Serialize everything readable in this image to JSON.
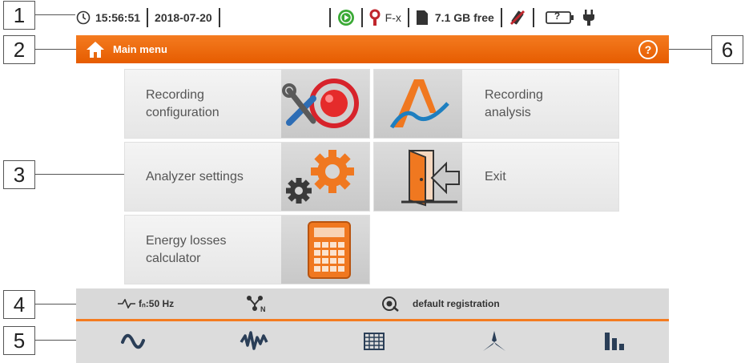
{
  "callouts": [
    "1",
    "2",
    "3",
    "4",
    "5",
    "6"
  ],
  "status": {
    "time": "15:56:51",
    "date": "2018-07-20",
    "phase": "F-x",
    "storage": "7.1 GB free",
    "battery": "?"
  },
  "titlebar": {
    "title": "Main menu",
    "help": "?"
  },
  "tiles": {
    "recording_configuration": "Recording\nconfiguration",
    "recording_analysis": "Recording\nanalysis",
    "analyzer_settings": "Analyzer settings",
    "exit": "Exit",
    "energy_losses_calculator": "Energy losses\ncalculator"
  },
  "infobar": {
    "frequency": "fₙ:50 Hz",
    "registration": "default registration"
  },
  "colors": {
    "accent": "#f47b20",
    "tile": "#ececec",
    "bar": "#d9d9d9"
  }
}
